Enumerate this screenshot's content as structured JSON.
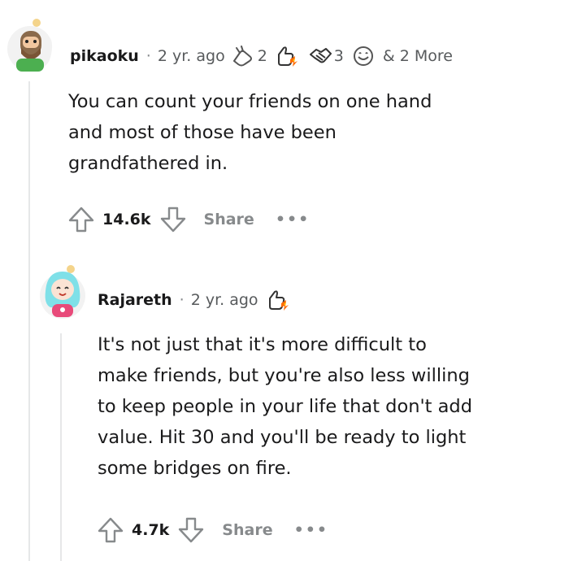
{
  "comments": [
    {
      "username": "pikaoku",
      "separator": "·",
      "time": "2 yr. ago",
      "awards": [
        {
          "icon": "hand-award-icon",
          "count": "2"
        },
        {
          "icon": "thumbs-up-award-icon",
          "count": ""
        },
        {
          "icon": "handshake-award-icon",
          "count": "3"
        },
        {
          "icon": "smile-award-icon",
          "count": ""
        }
      ],
      "more_awards": "& 2 More",
      "body": [
        "You can count your friends on one hand",
        "and most of those have been",
        "grandfathered in."
      ],
      "upvote_label": "",
      "votes": "14.6k",
      "share_label": "Share",
      "more_label": "•••"
    },
    {
      "username": "Rajareth",
      "separator": "·",
      "time": "2 yr. ago",
      "awards": [
        {
          "icon": "thumbs-up-award-icon",
          "count": ""
        }
      ],
      "body": [
        "It's not just that it's more difficult to",
        "make friends, but you're also less willing",
        "to keep people in your life that don't add",
        "value. Hit 30 and you'll be ready to light",
        "some bridges on fire."
      ],
      "votes": "4.7k",
      "share_label": "Share",
      "more_label": "•••"
    }
  ],
  "colors": {
    "text": "#1a1a1b",
    "meta": "#575a5c",
    "action": "#878a8c",
    "thread_line": "#e6e7e8"
  }
}
